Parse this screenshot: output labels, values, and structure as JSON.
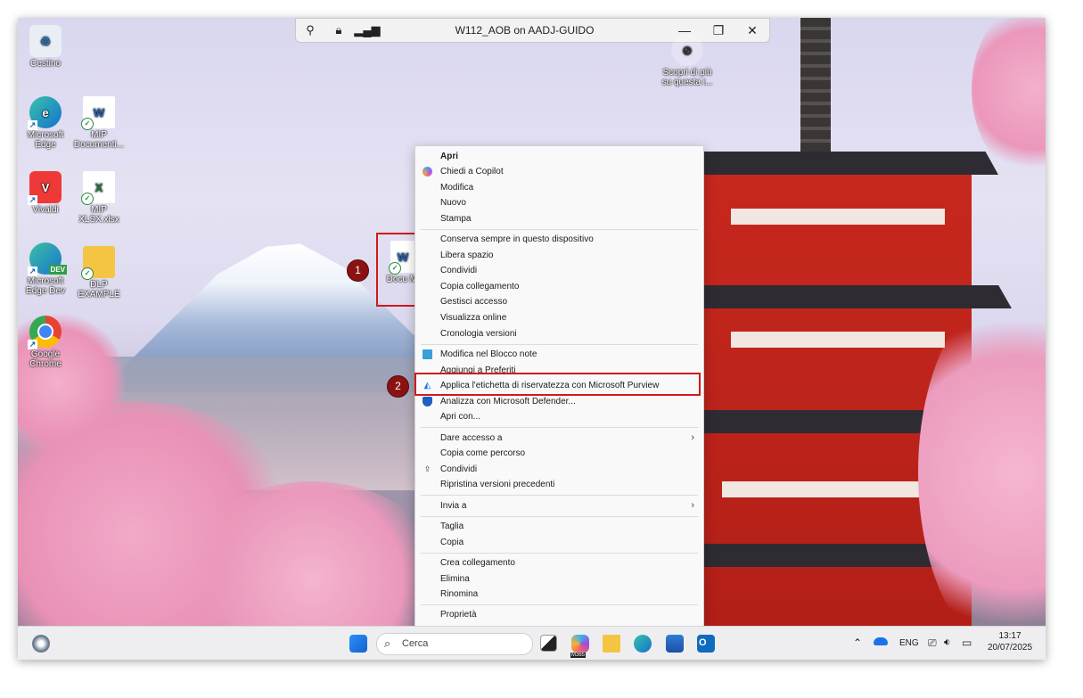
{
  "remote_bar": {
    "title": "W112_AOB on AADJ-GUIDO",
    "icons": [
      "pin-off-icon",
      "lock-icon",
      "signal-bars-icon"
    ],
    "minimize": "—",
    "restore": "❐",
    "close": "✕"
  },
  "desktop_icons": [
    {
      "label": "Cestino",
      "icon": "recycle-bin-icon"
    },
    {
      "label": "Microsoft Edge",
      "icon": "edge-icon"
    },
    {
      "label": "MIP Documenti...",
      "icon": "word-doc-icon"
    },
    {
      "label": "Vivaldi",
      "icon": "vivaldi-icon"
    },
    {
      "label": "MIP XLSX.xlsx",
      "icon": "excel-doc-icon"
    },
    {
      "label": "Microsoft Edge Dev",
      "icon": "edge-dev-icon"
    },
    {
      "label": "DLP EXAMPLE",
      "icon": "folder-icon"
    },
    {
      "label": "Google Chrome",
      "icon": "chrome-icon"
    },
    {
      "label": "Scopri di più su questa i...",
      "icon": "learn-more-icon"
    },
    {
      "label": "Docu Mi",
      "icon": "word-doc-selected-icon"
    }
  ],
  "edge_dev_badge": "DEV",
  "context_menu": {
    "group1": [
      "Apri",
      "Chiedi a Copilot",
      "Modifica",
      "Nuovo",
      "Stampa"
    ],
    "group2": [
      "Conserva sempre in questo dispositivo",
      "Libera spazio",
      "Condividi",
      "Copia collegamento",
      "Gestisci accesso",
      "Visualizza online",
      "Cronologia versioni"
    ],
    "group3": [
      "Modifica nel Blocco note",
      "Aggiungi a Preferiti",
      "Applica l'etichetta di riservatezza con Microsoft Purview",
      "Analizza con Microsoft Defender...",
      "Apri con..."
    ],
    "group4": [
      "Dare accesso a",
      "Copia come percorso",
      "Condividi",
      "Ripristina versioni precedenti"
    ],
    "group5": [
      "Invia a"
    ],
    "group6": [
      "Taglia",
      "Copia"
    ],
    "group7": [
      "Crea collegamento",
      "Elimina",
      "Rinomina"
    ],
    "group8": [
      "Proprietà"
    ],
    "submenu_arrow": "›"
  },
  "annotations": {
    "badge1": "1",
    "badge2": "2",
    "color": "#d11a1a"
  },
  "taskbar": {
    "search_placeholder": "Cerca",
    "language": "ENG",
    "time": "13:17",
    "date": "20/07/2025",
    "m365_label": "M365"
  }
}
